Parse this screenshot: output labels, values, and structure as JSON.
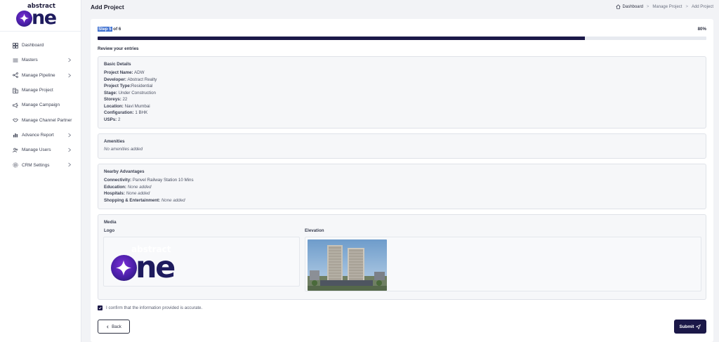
{
  "brand": {
    "logo_top": "abstract",
    "logo_rest": "ne",
    "accent_color": "#1b1848",
    "purple_color": "#7b2fd6"
  },
  "sidebar": {
    "items": [
      {
        "label": "Dashboard",
        "icon": "dashboard-icon",
        "has_chevron": false
      },
      {
        "label": "Masters",
        "icon": "list-icon",
        "has_chevron": true
      },
      {
        "label": "Manage Pipeline",
        "icon": "pipeline-icon",
        "has_chevron": true
      },
      {
        "label": "Manage Project",
        "icon": "building-icon",
        "has_chevron": false
      },
      {
        "label": "Manage Campaign",
        "icon": "megaphone-icon",
        "has_chevron": false
      },
      {
        "label": "Manage Channel Partner",
        "icon": "handshake-icon",
        "has_chevron": false
      },
      {
        "label": "Advance Report",
        "icon": "bar-chart-icon",
        "has_chevron": true
      },
      {
        "label": "Manage Users",
        "icon": "users-icon",
        "has_chevron": true
      },
      {
        "label": "CRM Settings",
        "icon": "gear-icon",
        "has_chevron": true
      }
    ]
  },
  "header": {
    "title": "Add Project",
    "breadcrumb": [
      "Dashboard",
      "Manage Project",
      "Add Project"
    ],
    "separator": ">"
  },
  "progress": {
    "step_prefix": "Step 5",
    "step_suffix": " of 6",
    "percent_label": "80%",
    "fraction": 0.8,
    "review_title": "Review your entries"
  },
  "basic": {
    "title": "Basic Details",
    "rows": [
      {
        "key": "Project Name:",
        "value": " ADW"
      },
      {
        "key": "Developer:",
        "value": " Abstract Realty"
      },
      {
        "key": "Project Type:",
        "value": "Residential"
      },
      {
        "key": "Stage:",
        "value": " Under Construction"
      },
      {
        "key": "Storeys:",
        "value": " 22"
      },
      {
        "key": "Location:",
        "value": " Navi Mumbai"
      },
      {
        "key": "Configuration:",
        "value": " 1 BHK"
      },
      {
        "key": "USPs:",
        "value": " 2"
      }
    ]
  },
  "amenities": {
    "title": "Amenities",
    "empty": "No amenities added"
  },
  "nearby": {
    "title": "Nearby Advantages",
    "rows": [
      {
        "key": "Connectivity:",
        "value": " Panvel Railway Station 10 Mins",
        "italic": false
      },
      {
        "key": "Education:",
        "value": " None added",
        "italic": true
      },
      {
        "key": "Hospitals:",
        "value": " None added",
        "italic": true
      },
      {
        "key": "Shopping & Entertainment:",
        "value": " None added",
        "italic": true
      }
    ]
  },
  "media": {
    "title": "Media",
    "logo_label": "Logo",
    "elevation_label": "Elevation"
  },
  "footer": {
    "confirm_text": "I confirm that the information provided is accurate.",
    "back_label": "Back",
    "submit_label": "Submit"
  }
}
